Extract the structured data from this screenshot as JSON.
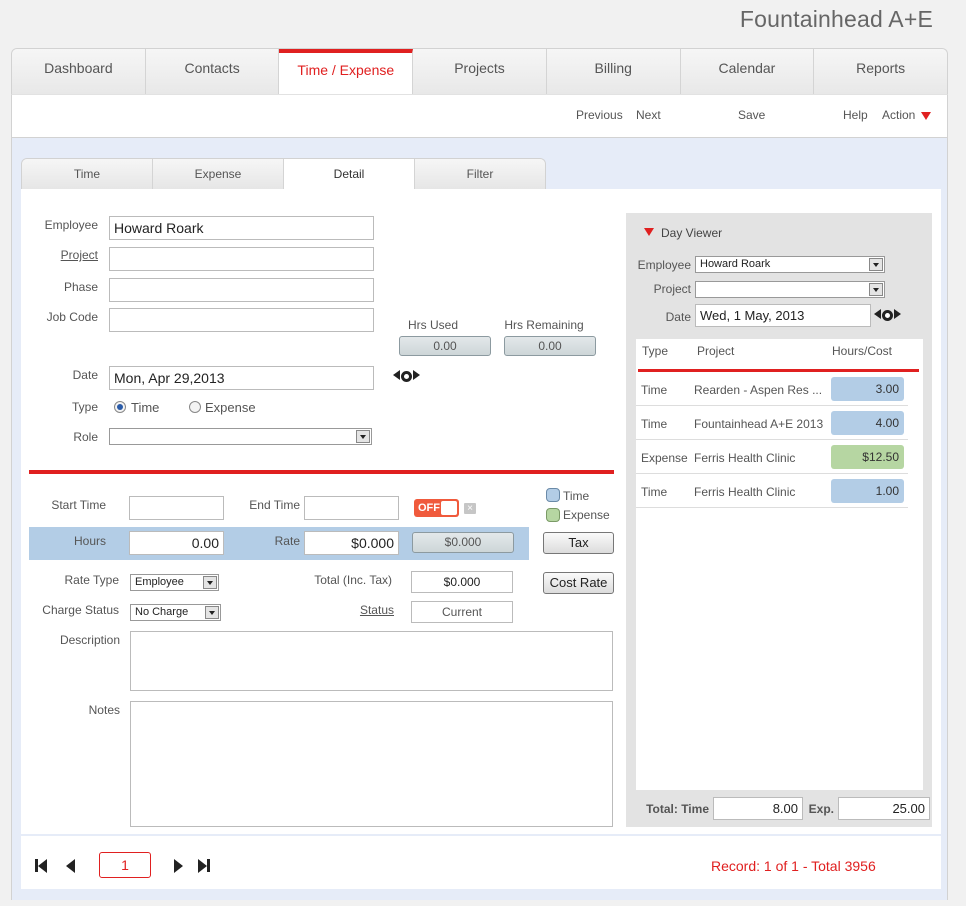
{
  "app": {
    "title": "Fountainhead A+E"
  },
  "main_tabs": [
    "Dashboard",
    "Contacts",
    "Time / Expense",
    "Projects",
    "Billing",
    "Calendar",
    "Reports"
  ],
  "toolbar": {
    "previous": "Previous",
    "next": "Next",
    "save": "Save",
    "help": "Help",
    "action": "Action"
  },
  "sub_tabs": [
    "Time",
    "Expense",
    "Detail",
    "Filter"
  ],
  "form": {
    "employee_label": "Employee",
    "employee_value": "Howard Roark",
    "project_label": "Project",
    "project_value": "",
    "phase_label": "Phase",
    "phase_value": "",
    "job_code_label": "Job Code",
    "job_code_value": "",
    "hrs_used_label": "Hrs Used",
    "hrs_used_value": "0.00",
    "hrs_remaining_label": "Hrs Remaining",
    "hrs_remaining_value": "0.00",
    "date_label": "Date",
    "date_value": "Mon, Apr 29,2013",
    "type_label": "Type",
    "type_time": "Time",
    "type_expense": "Expense",
    "role_label": "Role",
    "role_value": ""
  },
  "entry": {
    "start_time_label": "Start Time",
    "start_time_value": "",
    "end_time_label": "End Time",
    "end_time_value": "",
    "toggle_label": "OFF",
    "clear_label": "×",
    "legend_time": "Time",
    "legend_expense": "Expense",
    "hours_label": "Hours",
    "hours_value": "0.00",
    "rate_label": "Rate",
    "rate_value": "$0.000",
    "amount_value": "$0.000",
    "tax_button": "Tax",
    "rate_type_label": "Rate Type",
    "rate_type_value": "Employee",
    "total_label": "Total (Inc. Tax)",
    "total_value": "$0.000",
    "cost_rate_button": "Cost Rate",
    "charge_status_label": "Charge Status",
    "charge_status_value": "No Charge",
    "status_label": "Status",
    "status_value": "Current",
    "description_label": "Description",
    "notes_label": "Notes"
  },
  "day_viewer": {
    "title": "Day Viewer",
    "employee_label": "Employee",
    "employee_value": "Howard Roark",
    "project_label": "Project",
    "project_value": "",
    "date_label": "Date",
    "date_value": "Wed, 1 May, 2013",
    "columns": [
      "Type",
      "Project",
      "Hours/Cost"
    ],
    "rows": [
      {
        "type": "Time",
        "project": "Rearden - Aspen Res ...",
        "value": "3.00"
      },
      {
        "type": "Time",
        "project": "Fountainhead A+E 2013",
        "value": "4.00"
      },
      {
        "type": "Expense",
        "project": "Ferris Health Clinic",
        "value": "$12.50"
      },
      {
        "type": "Time",
        "project": "Ferris Health Clinic",
        "value": "1.00"
      }
    ],
    "total_label": "Total: Time",
    "total_time": "8.00",
    "exp_label": "Exp.",
    "total_exp": "25.00"
  },
  "footer": {
    "page_value": "1",
    "record_status": "Record: 1 of 1 - Total 3956"
  },
  "colors": {
    "accent": "#e02020",
    "time_fill": "#b3cde6",
    "expense_fill": "#b6d6a2"
  }
}
